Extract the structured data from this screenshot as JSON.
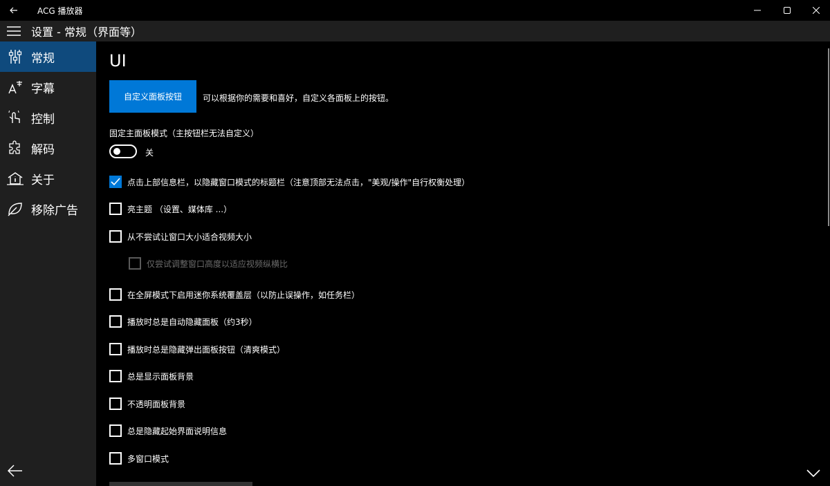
{
  "window": {
    "title": "ACG 播放器"
  },
  "header": {
    "title": "设置 - 常规（界面等）"
  },
  "sidebar": {
    "items": [
      {
        "label": "常规",
        "icon": "tuning-icon",
        "active": true
      },
      {
        "label": "字幕",
        "icon": "subtitle-icon",
        "active": false
      },
      {
        "label": "控制",
        "icon": "touch-icon",
        "active": false
      },
      {
        "label": "解码",
        "icon": "puzzle-icon",
        "active": false
      },
      {
        "label": "关于",
        "icon": "home-info-icon",
        "active": false
      },
      {
        "label": "移除广告",
        "icon": "leaf-icon",
        "active": false
      }
    ]
  },
  "main": {
    "section_title": "UI",
    "custom_button": "自定义面板按钮",
    "custom_description": "可以根据你的需要和喜好，自定义各面板上的按钮。",
    "fixed_panel": {
      "header": "固定主面板模式（主按钮栏无法自定义）",
      "state": "关",
      "on": false
    },
    "options": [
      {
        "label": "点击上部信息栏，以隐藏窗口模式的标题栏（注意顶部无法点击，\"美观/操作\"自行权衡处理）",
        "checked": true,
        "disabled": false
      },
      {
        "label": "亮主题 （设置、媒体库 ...）",
        "checked": false,
        "disabled": false
      },
      {
        "label": "从不尝试让窗口大小适合视频大小",
        "checked": false,
        "disabled": false
      },
      {
        "label": "仅尝试调整窗口高度以适应视频纵横比",
        "checked": false,
        "disabled": true
      },
      {
        "label": "在全屏模式下启用迷你系统覆盖层（以防止误操作，如任务栏）",
        "checked": false,
        "disabled": false
      },
      {
        "label": "播放时总是自动隐藏面板（约3秒）",
        "checked": false,
        "disabled": false
      },
      {
        "label": "播放时总是隐藏弹出面板按钮（清爽模式）",
        "checked": false,
        "disabled": false
      },
      {
        "label": "总是显示面板背景",
        "checked": false,
        "disabled": false
      },
      {
        "label": "不透明面板背景",
        "checked": false,
        "disabled": false
      },
      {
        "label": "总是隐藏起始界面说明信息",
        "checked": false,
        "disabled": false
      },
      {
        "label": "多窗口模式",
        "checked": false,
        "disabled": false
      }
    ]
  },
  "colors": {
    "accent": "#0078d7",
    "sidebar_bg": "#1f1f1f",
    "active_bg": "#0f4a7d",
    "page_bg": "#000000"
  }
}
